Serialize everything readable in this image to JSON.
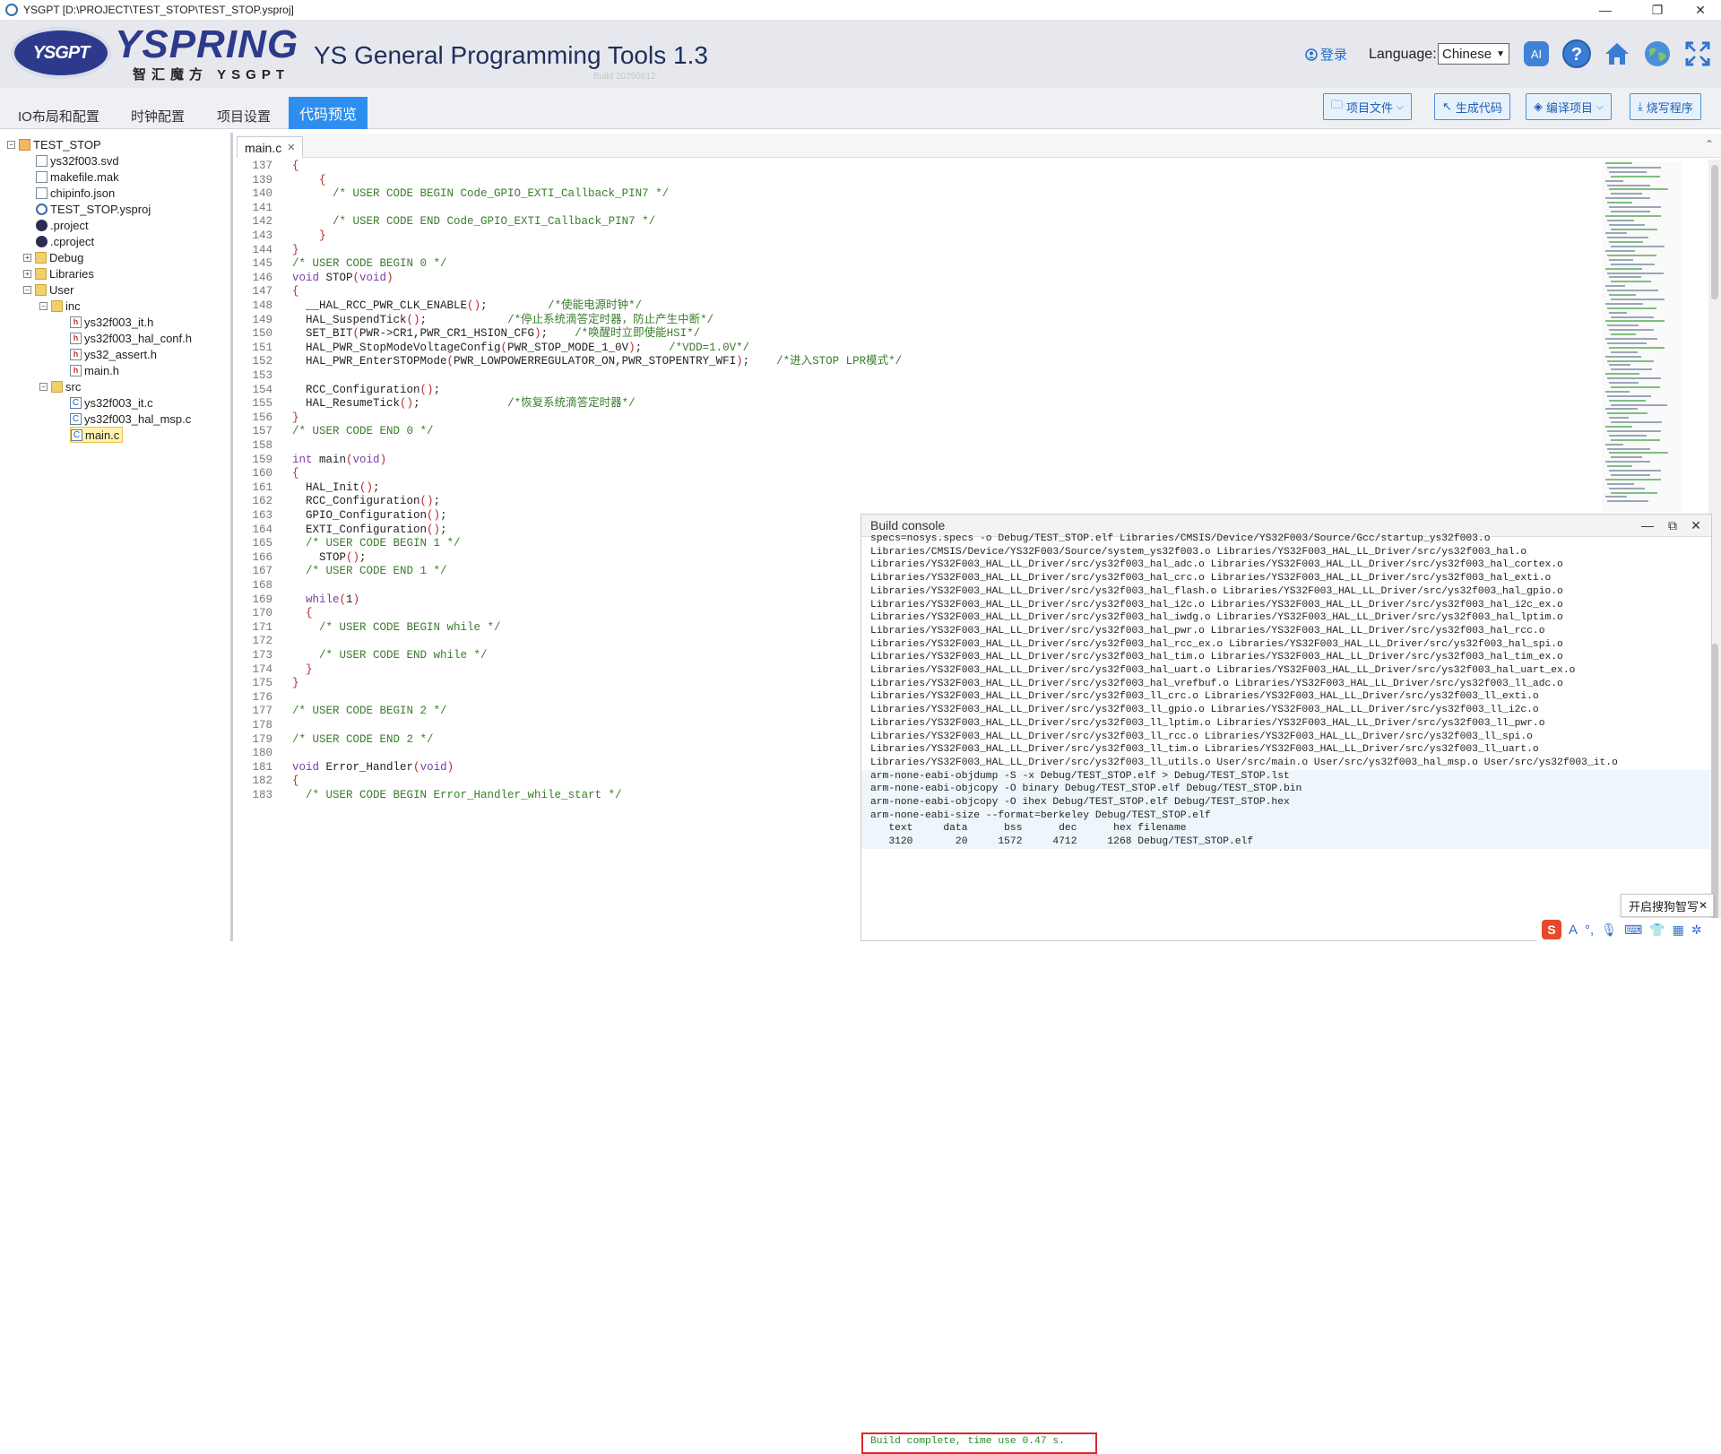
{
  "window": {
    "title": "YSGPT [D:\\PROJECT\\TEST_STOP\\TEST_STOP.ysproj]",
    "minimize": "—",
    "maximize": "❐",
    "close": "✕"
  },
  "header": {
    "logo_badge": "YSGPT",
    "logo_text": "YSPRING",
    "logo_sub": "智汇魔方 YSGPT",
    "app_title": "YS General Programming Tools 1.3",
    "build": "Build 20250612",
    "login": "登录",
    "language_label": "Language:",
    "language_value": "Chinese",
    "ai_label": "AI"
  },
  "tabs": [
    "IO布局和配置",
    "时钟配置",
    "项目设置",
    "代码预览"
  ],
  "toolbar": {
    "project_files": "项目文件",
    "generate": "生成代码",
    "compile": "编译项目",
    "flash": "烧写程序"
  },
  "tree": [
    {
      "label": "TEST_STOP"
    },
    {
      "label": "ys32f003.svd"
    },
    {
      "label": "makefile.mak"
    },
    {
      "label": "chipinfo.json"
    },
    {
      "label": "TEST_STOP.ysproj"
    },
    {
      "label": ".project"
    },
    {
      "label": ".cproject"
    },
    {
      "label": "Debug"
    },
    {
      "label": "Libraries"
    },
    {
      "label": "User"
    },
    {
      "label": "inc"
    },
    {
      "label": "ys32f003_it.h"
    },
    {
      "label": "ys32f003_hal_conf.h"
    },
    {
      "label": "ys32_assert.h"
    },
    {
      "label": "main.h"
    },
    {
      "label": "src"
    },
    {
      "label": "ys32f003_it.c"
    },
    {
      "label": "ys32f003_hal_msp.c"
    },
    {
      "label": "main.c"
    }
  ],
  "editor": {
    "tab": "main.c",
    "lines": [
      {
        "n": "137",
        "t": "{"
      },
      {
        "n": "139",
        "t": "    {"
      },
      {
        "n": "140",
        "t": "      /* USER CODE BEGIN Code_GPIO_EXTI_Callback_PIN7 */"
      },
      {
        "n": "141",
        "t": ""
      },
      {
        "n": "142",
        "t": "      /* USER CODE END Code_GPIO_EXTI_Callback_PIN7 */"
      },
      {
        "n": "143",
        "t": "    }"
      },
      {
        "n": "144",
        "t": "}"
      },
      {
        "n": "145",
        "t": "/* USER CODE BEGIN 0 */"
      },
      {
        "n": "146",
        "t": "void STOP(void)"
      },
      {
        "n": "147",
        "t": "{"
      },
      {
        "n": "148",
        "t": "  __HAL_RCC_PWR_CLK_ENABLE();         /*使能电源时钟*/"
      },
      {
        "n": "149",
        "t": "  HAL_SuspendTick();            /*停止系统滴答定时器，防止产生中断*/"
      },
      {
        "n": "150",
        "t": "  SET_BIT(PWR->CR1,PWR_CR1_HSION_CFG);    /*唤醒时立即使能HSI*/"
      },
      {
        "n": "151",
        "t": "  HAL_PWR_StopModeVoltageConfig(PWR_STOP_MODE_1_0V);    /*VDD=1.0V*/"
      },
      {
        "n": "152",
        "t": "  HAL_PWR_EnterSTOPMode(PWR_LOWPOWERREGULATOR_ON,PWR_STOPENTRY_WFI);    /*进入STOP LPR模式*/"
      },
      {
        "n": "153",
        "t": ""
      },
      {
        "n": "154",
        "t": "  RCC_Configuration();"
      },
      {
        "n": "155",
        "t": "  HAL_ResumeTick();             /*恢复系统滴答定时器*/"
      },
      {
        "n": "156",
        "t": "}"
      },
      {
        "n": "157",
        "t": "/* USER CODE END 0 */"
      },
      {
        "n": "158",
        "t": ""
      },
      {
        "n": "159",
        "t": "int main(void)"
      },
      {
        "n": "160",
        "t": "{"
      },
      {
        "n": "161",
        "t": "  HAL_Init();"
      },
      {
        "n": "162",
        "t": "  RCC_Configuration();"
      },
      {
        "n": "163",
        "t": "  GPIO_Configuration();"
      },
      {
        "n": "164",
        "t": "  EXTI_Configuration();"
      },
      {
        "n": "165",
        "t": "  /* USER CODE BEGIN 1 */"
      },
      {
        "n": "166",
        "t": "    STOP();"
      },
      {
        "n": "167",
        "t": "  /* USER CODE END 1 */"
      },
      {
        "n": "168",
        "t": ""
      },
      {
        "n": "169",
        "t": "  while(1)"
      },
      {
        "n": "170",
        "t": "  {"
      },
      {
        "n": "171",
        "t": "    /* USER CODE BEGIN while */"
      },
      {
        "n": "172",
        "t": ""
      },
      {
        "n": "173",
        "t": "    /* USER CODE END while */"
      },
      {
        "n": "174",
        "t": "  }"
      },
      {
        "n": "175",
        "t": "}"
      },
      {
        "n": "176",
        "t": ""
      },
      {
        "n": "177",
        "t": "/* USER CODE BEGIN 2 */"
      },
      {
        "n": "178",
        "t": ""
      },
      {
        "n": "179",
        "t": "/* USER CODE END 2 */"
      },
      {
        "n": "180",
        "t": ""
      },
      {
        "n": "181",
        "t": "void Error_Handler(void)"
      },
      {
        "n": "182",
        "t": "{"
      },
      {
        "n": "183",
        "t": "  /* USER CODE BEGIN Error_Handler_while_start */"
      }
    ]
  },
  "console": {
    "title": "Build console",
    "lines": [
      "specs=nosys.specs -o Debug/TEST_STOP.elf Libraries/CMSIS/Device/YS32F003/Source/Gcc/startup_ys32f003.o",
      "Libraries/CMSIS/Device/YS32F003/Source/system_ys32f003.o Libraries/YS32F003_HAL_LL_Driver/src/ys32f003_hal.o",
      "Libraries/YS32F003_HAL_LL_Driver/src/ys32f003_hal_adc.o Libraries/YS32F003_HAL_LL_Driver/src/ys32f003_hal_cortex.o",
      "Libraries/YS32F003_HAL_LL_Driver/src/ys32f003_hal_crc.o Libraries/YS32F003_HAL_LL_Driver/src/ys32f003_hal_exti.o",
      "Libraries/YS32F003_HAL_LL_Driver/src/ys32f003_hal_flash.o Libraries/YS32F003_HAL_LL_Driver/src/ys32f003_hal_gpio.o",
      "Libraries/YS32F003_HAL_LL_Driver/src/ys32f003_hal_i2c.o Libraries/YS32F003_HAL_LL_Driver/src/ys32f003_hal_i2c_ex.o",
      "Libraries/YS32F003_HAL_LL_Driver/src/ys32f003_hal_iwdg.o Libraries/YS32F003_HAL_LL_Driver/src/ys32f003_hal_lptim.o",
      "Libraries/YS32F003_HAL_LL_Driver/src/ys32f003_hal_pwr.o Libraries/YS32F003_HAL_LL_Driver/src/ys32f003_hal_rcc.o",
      "Libraries/YS32F003_HAL_LL_Driver/src/ys32f003_hal_rcc_ex.o Libraries/YS32F003_HAL_LL_Driver/src/ys32f003_hal_spi.o",
      "Libraries/YS32F003_HAL_LL_Driver/src/ys32f003_hal_tim.o Libraries/YS32F003_HAL_LL_Driver/src/ys32f003_hal_tim_ex.o",
      "Libraries/YS32F003_HAL_LL_Driver/src/ys32f003_hal_uart.o Libraries/YS32F003_HAL_LL_Driver/src/ys32f003_hal_uart_ex.o",
      "Libraries/YS32F003_HAL_LL_Driver/src/ys32f003_hal_vrefbuf.o Libraries/YS32F003_HAL_LL_Driver/src/ys32f003_ll_adc.o",
      "Libraries/YS32F003_HAL_LL_Driver/src/ys32f003_ll_crc.o Libraries/YS32F003_HAL_LL_Driver/src/ys32f003_ll_exti.o",
      "Libraries/YS32F003_HAL_LL_Driver/src/ys32f003_ll_gpio.o Libraries/YS32F003_HAL_LL_Driver/src/ys32f003_ll_i2c.o",
      "Libraries/YS32F003_HAL_LL_Driver/src/ys32f003_ll_lptim.o Libraries/YS32F003_HAL_LL_Driver/src/ys32f003_ll_pwr.o",
      "Libraries/YS32F003_HAL_LL_Driver/src/ys32f003_ll_rcc.o Libraries/YS32F003_HAL_LL_Driver/src/ys32f003_ll_spi.o",
      "Libraries/YS32F003_HAL_LL_Driver/src/ys32f003_ll_tim.o Libraries/YS32F003_HAL_LL_Driver/src/ys32f003_ll_uart.o",
      "Libraries/YS32F003_HAL_LL_Driver/src/ys32f003_ll_utils.o User/src/main.o User/src/ys32f003_hal_msp.o User/src/ys32f003_it.o",
      "arm-none-eabi-objdump -S -x Debug/TEST_STOP.elf > Debug/TEST_STOP.lst",
      "arm-none-eabi-objcopy -O binary Debug/TEST_STOP.elf Debug/TEST_STOP.bin",
      "arm-none-eabi-objcopy -O ihex Debug/TEST_STOP.elf Debug/TEST_STOP.hex",
      "arm-none-eabi-size --format=berkeley Debug/TEST_STOP.elf",
      "   text     data      bss      dec      hex filename",
      "   3120       20     1572     4712     1268 Debug/TEST_STOP.elf"
    ],
    "status": "Build complete, time use 0.47 s."
  },
  "ime": {
    "popup": "开启搜狗智写",
    "close": "✕"
  },
  "colors": {
    "accent": "#2e8ef0",
    "comment": "#3a7d2c",
    "keyword": "#7a3ea5",
    "highlight": "#e0262b"
  }
}
